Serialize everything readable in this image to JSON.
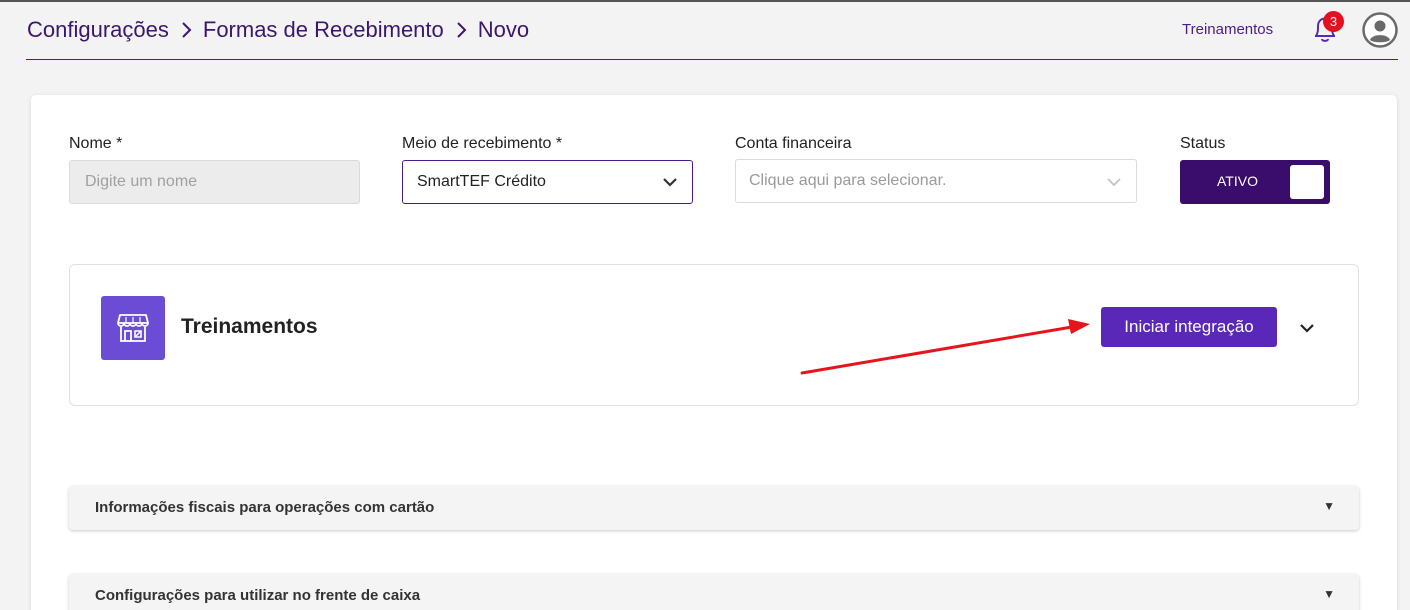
{
  "header": {
    "breadcrumb": [
      "Configurações",
      "Formas de Recebimento",
      "Novo"
    ],
    "link_label": "Treinamentos",
    "notification_count": "3"
  },
  "form": {
    "nome": {
      "label": "Nome *",
      "placeholder": "Digite um nome",
      "value": ""
    },
    "meio": {
      "label": "Meio de recebimento *",
      "value": "SmartTEF Crédito"
    },
    "conta": {
      "label": "Conta financeira",
      "placeholder": "Clique aqui para selecionar."
    },
    "status": {
      "label": "Status",
      "value": "ATIVO",
      "on": true
    }
  },
  "integration": {
    "title": "Treinamentos",
    "button_label": "Iniciar integração",
    "icon": "store-icon"
  },
  "accordions": [
    {
      "label": "Informações fiscais para operações com cartão",
      "caret": "▼"
    },
    {
      "label": "Configurações para utilizar no frente de caixa",
      "caret": "▼"
    }
  ],
  "colors": {
    "brand": "#4b1d86",
    "toggle_bg": "#3a0d6c",
    "button_bg": "#5a28b8",
    "icon_bg": "#6a4dd4",
    "badge_bg": "#e3101f",
    "annotation_arrow": "#e8141b"
  }
}
